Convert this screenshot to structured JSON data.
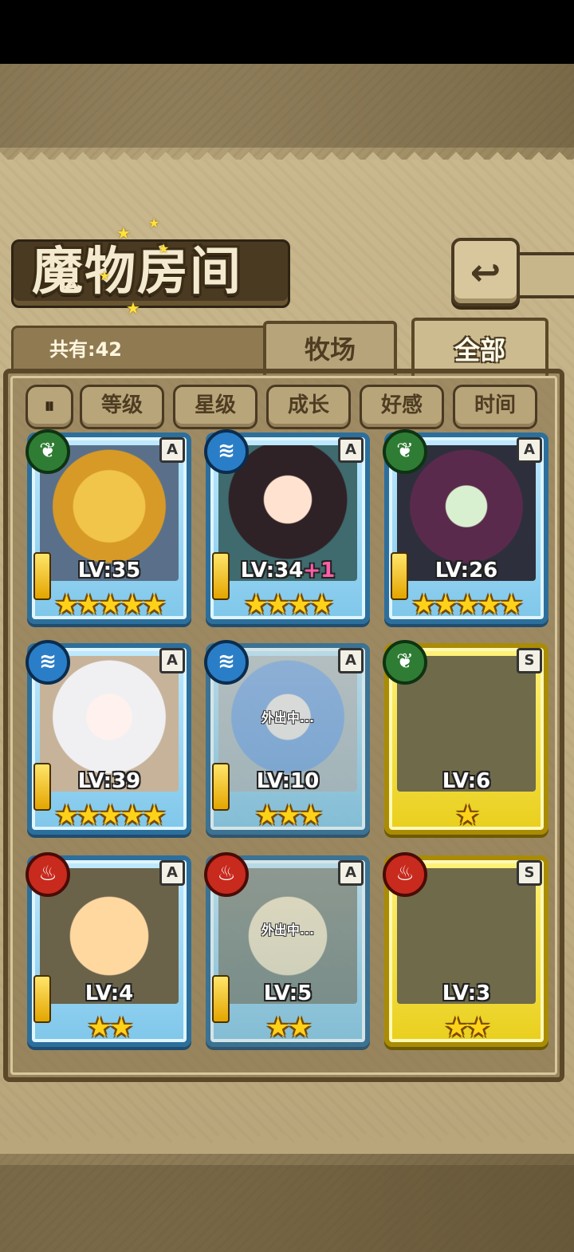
{
  "title": "魔物房间",
  "back_icon": "back-arrow-icon",
  "count_label": "共有:42",
  "tabs": [
    {
      "label": "牧场",
      "active": false
    },
    {
      "label": "全部",
      "active": true
    }
  ],
  "sort_toggle_icon": "pause-sort-icon",
  "sort_buttons": [
    "等级",
    "星级",
    "成长",
    "好感",
    "时间"
  ],
  "cards": [
    {
      "element": "grass",
      "rank": "A",
      "level": "LV:35",
      "bonus": "",
      "stars": 5,
      "stars_text": "★★★★★",
      "frame": "blue",
      "away": ""
    },
    {
      "element": "water",
      "rank": "A",
      "level": "LV:34",
      "bonus": "+1",
      "stars": 4,
      "stars_text": "★★★★",
      "frame": "blue",
      "away": ""
    },
    {
      "element": "grass",
      "rank": "A",
      "level": "LV:26",
      "bonus": "",
      "stars": 5,
      "stars_text": "★★★★★",
      "frame": "blue",
      "away": ""
    },
    {
      "element": "water",
      "rank": "A",
      "level": "LV:39",
      "bonus": "",
      "stars": 5,
      "stars_text": "★★★★★",
      "frame": "blue",
      "away": ""
    },
    {
      "element": "water",
      "rank": "A",
      "level": "LV:10",
      "bonus": "",
      "stars": 3,
      "stars_text": "★★★",
      "frame": "blue",
      "away": "外出中..."
    },
    {
      "element": "grass",
      "rank": "S",
      "level": "LV:6",
      "bonus": "",
      "stars": 1,
      "stars_text": "★",
      "frame": "gold",
      "away": ""
    },
    {
      "element": "fire",
      "rank": "A",
      "level": "LV:4",
      "bonus": "",
      "stars": 2,
      "stars_text": "★★",
      "frame": "blue",
      "away": ""
    },
    {
      "element": "fire",
      "rank": "A",
      "level": "LV:5",
      "bonus": "",
      "stars": 2,
      "stars_text": "★★",
      "frame": "blue",
      "away": "外出中..."
    },
    {
      "element": "fire",
      "rank": "S",
      "level": "LV:3",
      "bonus": "",
      "stars": 2,
      "stars_text": "★★",
      "frame": "gold",
      "away": ""
    }
  ],
  "element_icons": {
    "grass": "leaf-icon",
    "water": "wave-icon",
    "fire": "flame-icon"
  }
}
